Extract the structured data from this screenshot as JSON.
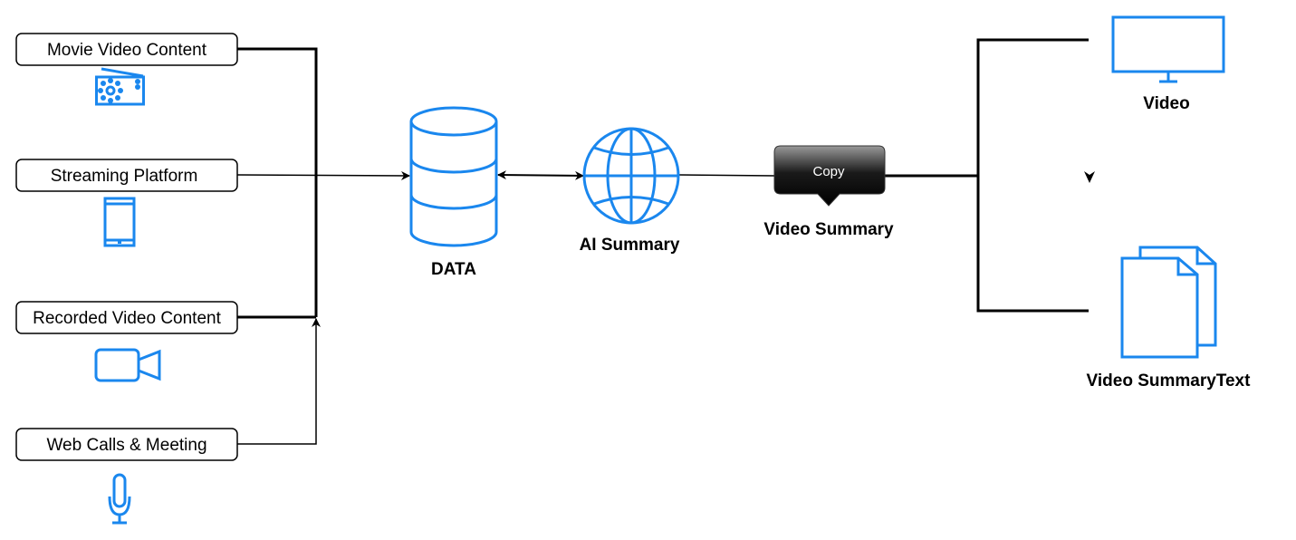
{
  "sources": [
    {
      "label": "Movie Video Content",
      "icon": "radio-icon"
    },
    {
      "label": "Streaming Platform",
      "icon": "smartphone-icon"
    },
    {
      "label": "Recorded Video Content",
      "icon": "video-camera-icon"
    },
    {
      "label": "Web Calls & Meeting",
      "icon": "microphone-icon"
    }
  ],
  "data_node": {
    "label": "DATA",
    "icon": "database-icon"
  },
  "ai_node": {
    "label": "AI Summary",
    "icon": "globe-icon"
  },
  "summary_node": {
    "label": "Video Summary",
    "tooltip": "Copy"
  },
  "outputs": [
    {
      "label": "Video",
      "icon": "monitor-icon"
    },
    {
      "label": "Video SummaryText",
      "icon": "documents-icon"
    }
  ],
  "colors": {
    "icon": "#1a87ee",
    "line": "#000000"
  }
}
